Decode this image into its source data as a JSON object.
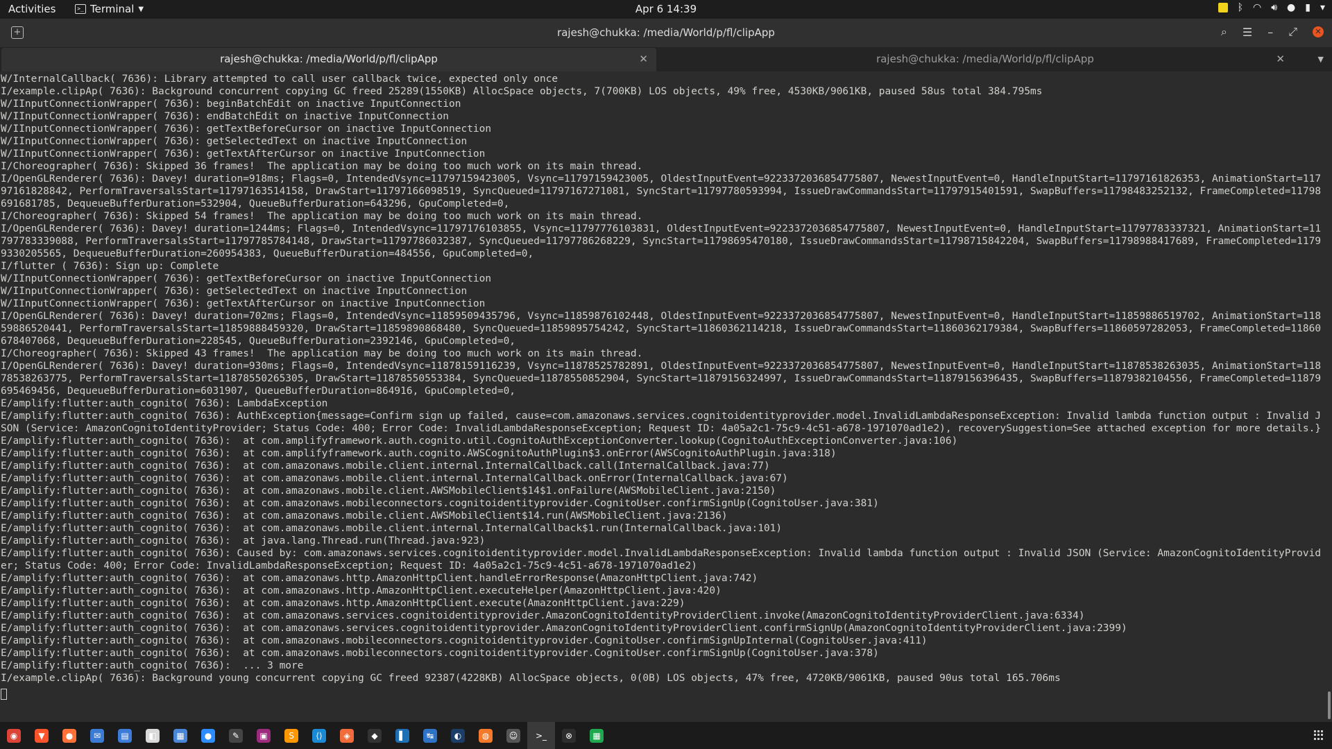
{
  "top_panel": {
    "activities": "Activities",
    "app_name": "Terminal",
    "datetime": "Apr 6  14:39"
  },
  "window": {
    "title": "rajesh@chukka: /media/World/p/fl/clipApp"
  },
  "tabs": [
    {
      "label": "rajesh@chukka: /media/World/p/fl/clipApp",
      "active": true
    },
    {
      "label": "rajesh@chukka: /media/World/p/fl/clipApp",
      "active": false
    }
  ],
  "terminal": {
    "lines": [
      "W/InternalCallback( 7636): Library attempted to call user callback twice, expected only once",
      "I/example.clipAp( 7636): Background concurrent copying GC freed 25289(1550KB) AllocSpace objects, 7(700KB) LOS objects, 49% free, 4530KB/9061KB, paused 58us total 384.795ms",
      "W/IInputConnectionWrapper( 7636): beginBatchEdit on inactive InputConnection",
      "W/IInputConnectionWrapper( 7636): endBatchEdit on inactive InputConnection",
      "W/IInputConnectionWrapper( 7636): getTextBeforeCursor on inactive InputConnection",
      "W/IInputConnectionWrapper( 7636): getSelectedText on inactive InputConnection",
      "W/IInputConnectionWrapper( 7636): getTextAfterCursor on inactive InputConnection",
      "I/Choreographer( 7636): Skipped 36 frames!  The application may be doing too much work on its main thread.",
      "I/OpenGLRenderer( 7636): Davey! duration=918ms; Flags=0, IntendedVsync=11797159423005, Vsync=11797159423005, OldestInputEvent=9223372036854775807, NewestInputEvent=0, HandleInputStart=11797161826353, AnimationStart=11797161828842, PerformTraversalsStart=11797163514158, DrawStart=11797166098519, SyncQueued=11797167271081, SyncStart=11797780593994, IssueDrawCommandsStart=11797915401591, SwapBuffers=11798483252132, FrameCompleted=11798691681785, DequeueBufferDuration=532904, QueueBufferDuration=643296, GpuCompleted=0,",
      "I/Choreographer( 7636): Skipped 54 frames!  The application may be doing too much work on its main thread.",
      "I/OpenGLRenderer( 7636): Davey! duration=1244ms; Flags=0, IntendedVsync=11797176103855, Vsync=11797776103831, OldestInputEvent=9223372036854775807, NewestInputEvent=0, HandleInputStart=11797783337321, AnimationStart=11797783339088, PerformTraversalsStart=11797785784148, DrawStart=11797786032387, SyncQueued=11797786268229, SyncStart=11798695470180, IssueDrawCommandsStart=11798715842204, SwapBuffers=11798988417689, FrameCompleted=11799330205565, DequeueBufferDuration=260954383, QueueBufferDuration=484556, GpuCompleted=0,",
      "I/flutter ( 7636): Sign up: Complete",
      "W/IInputConnectionWrapper( 7636): getTextBeforeCursor on inactive InputConnection",
      "W/IInputConnectionWrapper( 7636): getSelectedText on inactive InputConnection",
      "W/IInputConnectionWrapper( 7636): getTextAfterCursor on inactive InputConnection",
      "I/OpenGLRenderer( 7636): Davey! duration=702ms; Flags=0, IntendedVsync=11859509435796, Vsync=11859876102448, OldestInputEvent=9223372036854775807, NewestInputEvent=0, HandleInputStart=11859886519702, AnimationStart=11859886520441, PerformTraversalsStart=11859888459320, DrawStart=11859890868480, SyncQueued=11859895754242, SyncStart=11860362114218, IssueDrawCommandsStart=11860362179384, SwapBuffers=11860597282053, FrameCompleted=11860678407068, DequeueBufferDuration=228545, QueueBufferDuration=2392146, GpuCompleted=0,",
      "I/Choreographer( 7636): Skipped 43 frames!  The application may be doing too much work on its main thread.",
      "I/OpenGLRenderer( 7636): Davey! duration=930ms; Flags=0, IntendedVsync=11878159116239, Vsync=11878525782891, OldestInputEvent=9223372036854775807, NewestInputEvent=0, HandleInputStart=11878538263035, AnimationStart=11878538263775, PerformTraversalsStart=11878550265305, DrawStart=11878550553384, SyncQueued=11878550852904, SyncStart=11879156324997, IssueDrawCommandsStart=11879156396435, SwapBuffers=11879382104556, FrameCompleted=11879695469456, DequeueBufferDuration=6031907, QueueBufferDuration=864916, GpuCompleted=0,",
      "E/amplify:flutter:auth_cognito( 7636): LambdaException",
      "E/amplify:flutter:auth_cognito( 7636): AuthException{message=Confirm sign up failed, cause=com.amazonaws.services.cognitoidentityprovider.model.InvalidLambdaResponseException: Invalid lambda function output : Invalid JSON (Service: AmazonCognitoIdentityProvider; Status Code: 400; Error Code: InvalidLambdaResponseException; Request ID: 4a05a2c1-75c9-4c51-a678-1971070ad1e2), recoverySuggestion=See attached exception for more details.}",
      "E/amplify:flutter:auth_cognito( 7636):  at com.amplifyframework.auth.cognito.util.CognitoAuthExceptionConverter.lookup(CognitoAuthExceptionConverter.java:106)",
      "E/amplify:flutter:auth_cognito( 7636):  at com.amplifyframework.auth.cognito.AWSCognitoAuthPlugin$3.onError(AWSCognitoAuthPlugin.java:318)",
      "E/amplify:flutter:auth_cognito( 7636):  at com.amazonaws.mobile.client.internal.InternalCallback.call(InternalCallback.java:77)",
      "E/amplify:flutter:auth_cognito( 7636):  at com.amazonaws.mobile.client.internal.InternalCallback.onError(InternalCallback.java:67)",
      "E/amplify:flutter:auth_cognito( 7636):  at com.amazonaws.mobile.client.AWSMobileClient$14$1.onFailure(AWSMobileClient.java:2150)",
      "E/amplify:flutter:auth_cognito( 7636):  at com.amazonaws.mobileconnectors.cognitoidentityprovider.CognitoUser.confirmSignUp(CognitoUser.java:381)",
      "E/amplify:flutter:auth_cognito( 7636):  at com.amazonaws.mobile.client.AWSMobileClient$14.run(AWSMobileClient.java:2136)",
      "E/amplify:flutter:auth_cognito( 7636):  at com.amazonaws.mobile.client.internal.InternalCallback$1.run(InternalCallback.java:101)",
      "E/amplify:flutter:auth_cognito( 7636):  at java.lang.Thread.run(Thread.java:923)",
      "E/amplify:flutter:auth_cognito( 7636): Caused by: com.amazonaws.services.cognitoidentityprovider.model.InvalidLambdaResponseException: Invalid lambda function output : Invalid JSON (Service: AmazonCognitoIdentityProvider; Status Code: 400; Error Code: InvalidLambdaResponseException; Request ID: 4a05a2c1-75c9-4c51-a678-1971070ad1e2)",
      "E/amplify:flutter:auth_cognito( 7636):  at com.amazonaws.http.AmazonHttpClient.handleErrorResponse(AmazonHttpClient.java:742)",
      "E/amplify:flutter:auth_cognito( 7636):  at com.amazonaws.http.AmazonHttpClient.executeHelper(AmazonHttpClient.java:420)",
      "E/amplify:flutter:auth_cognito( 7636):  at com.amazonaws.http.AmazonHttpClient.execute(AmazonHttpClient.java:229)",
      "E/amplify:flutter:auth_cognito( 7636):  at com.amazonaws.services.cognitoidentityprovider.AmazonCognitoIdentityProviderClient.invoke(AmazonCognitoIdentityProviderClient.java:6334)",
      "E/amplify:flutter:auth_cognito( 7636):  at com.amazonaws.services.cognitoidentityprovider.AmazonCognitoIdentityProviderClient.confirmSignUp(AmazonCognitoIdentityProviderClient.java:2399)",
      "E/amplify:flutter:auth_cognito( 7636):  at com.amazonaws.mobileconnectors.cognitoidentityprovider.CognitoUser.confirmSignUpInternal(CognitoUser.java:411)",
      "E/amplify:flutter:auth_cognito( 7636):  at com.amazonaws.mobileconnectors.cognitoidentityprovider.CognitoUser.confirmSignUp(CognitoUser.java:378)",
      "E/amplify:flutter:auth_cognito( 7636):  ... 3 more",
      "I/example.clipAp( 7636): Background young concurrent copying GC freed 92387(4228KB) AllocSpace objects, 0(0B) LOS objects, 47% free, 4720KB/9061KB, paused 90us total 165.706ms"
    ]
  },
  "dock": {
    "items": [
      {
        "name": "chrome-icon",
        "color": "#db4437",
        "glyph": "◉"
      },
      {
        "name": "brave-icon",
        "color": "#fb542b",
        "glyph": "▼"
      },
      {
        "name": "firefox-icon",
        "color": "#ff7139",
        "glyph": "●"
      },
      {
        "name": "thunderbird-icon",
        "color": "#3b7bd4",
        "glyph": "✉"
      },
      {
        "name": "files-icon",
        "color": "#3d7bd9",
        "glyph": "▤"
      },
      {
        "name": "software-icon",
        "color": "#d9d9d9",
        "glyph": "◧"
      },
      {
        "name": "text-editor-icon",
        "color": "#4a86d8",
        "glyph": "▦"
      },
      {
        "name": "zoom-icon",
        "color": "#2d8cff",
        "glyph": "●"
      },
      {
        "name": "tool-icon",
        "color": "#444444",
        "glyph": "✎"
      },
      {
        "name": "jetbrains-icon",
        "color": "#9c2a7d",
        "glyph": "▣"
      },
      {
        "name": "sublime-icon",
        "color": "#ff9800",
        "glyph": "S"
      },
      {
        "name": "vscode-icon",
        "color": "#1a8ad4",
        "glyph": "⟨⟩"
      },
      {
        "name": "postman-icon",
        "color": "#f26b3a",
        "glyph": "◈"
      },
      {
        "name": "unity-icon",
        "color": "#333333",
        "glyph": "◆"
      },
      {
        "name": "android-studio-icon",
        "color": "#1f6fb5",
        "glyph": "▌"
      },
      {
        "name": "sourcetree-icon",
        "color": "#2f73c7",
        "glyph": "↹"
      },
      {
        "name": "steam-icon",
        "color": "#1b3d66",
        "glyph": "◐"
      },
      {
        "name": "blender-icon",
        "color": "#f5792a",
        "glyph": "◍"
      },
      {
        "name": "gimp-icon",
        "color": "#555555",
        "glyph": "☺"
      },
      {
        "name": "terminal-icon",
        "color": "#3a3a3a",
        "glyph": ">_",
        "active": true
      },
      {
        "name": "xbox-icon",
        "color": "#2d2d2d",
        "glyph": "⊗"
      },
      {
        "name": "spreadsheet-icon",
        "color": "#1fa84f",
        "glyph": "▦"
      }
    ]
  }
}
